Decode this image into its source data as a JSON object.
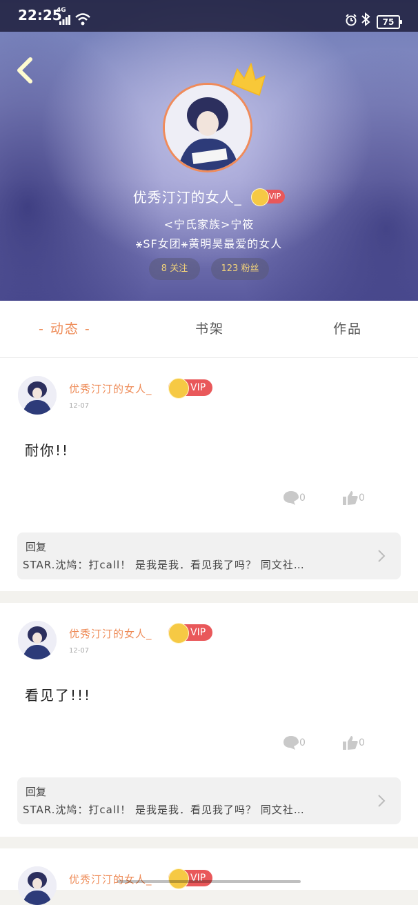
{
  "status_bar": {
    "time": "22:25",
    "network": "4G",
    "battery": "75"
  },
  "profile": {
    "name": "优秀汀汀的女人_",
    "vip": "VIP",
    "bio_line1": "<宁氏家族>宁筱",
    "bio_line2": "⚹SF女团⚹黄明昊最爱的女人",
    "follow": "8 关注",
    "fans": "123 粉丝"
  },
  "tabs": {
    "active": "- 动态 -",
    "shelf": "书架",
    "works": "作品"
  },
  "posts": [
    {
      "author": "优秀汀汀的女人_",
      "vip": "VIP",
      "date": "12-07",
      "content": "耐你!!",
      "comments": "0",
      "likes": "0",
      "reply_label": "回复",
      "reply_text": "STAR.沈鸠：打call！ 是我是我．看见我了吗？ 同文社…"
    },
    {
      "author": "优秀汀汀的女人_",
      "vip": "VIP",
      "date": "12-07",
      "content": "看见了!!!",
      "comments": "0",
      "likes": "0",
      "reply_label": "回复",
      "reply_text": "STAR.沈鸠：打call！ 是我是我．看见我了吗？ 同文社…"
    },
    {
      "author": "优秀汀汀的女人_",
      "vip": "VIP"
    }
  ],
  "colors": {
    "accent": "#ee8b57",
    "vip": "#e9585a",
    "crown": "#f6c944"
  }
}
